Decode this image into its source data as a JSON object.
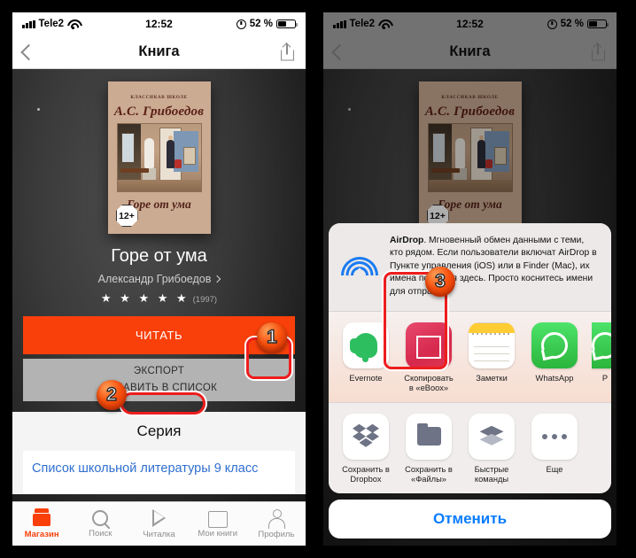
{
  "status_bar": {
    "carrier": "Tele2",
    "time": "12:52",
    "battery": "52 %"
  },
  "nav": {
    "title": "Книга",
    "back_icon": "chevron-left-icon",
    "share_icon": "share-icon"
  },
  "book": {
    "cover": {
      "series_left": "КЛАССИКА",
      "series_right": "В ШКОЛЕ",
      "author": "А.С. Грибоедов",
      "title": "Горе от ума",
      "age_rating": "12+"
    },
    "title": "Горе от ума",
    "author": "Александр Грибоедов",
    "stars": "★ ★ ★ ★ ★",
    "ratings_count": "(1997)",
    "read_button": "ЧИТАТЬ",
    "expand_icon": "chevron-up-icon",
    "export_button": "ЭКСПОРТ",
    "add_to_list_button": "ДОБАВИТЬ В СПИСОК"
  },
  "series": {
    "heading": "Серия",
    "link": "Список школьной литературы 9 класс"
  },
  "tabbar": {
    "items": [
      {
        "label": "Магазин",
        "icon": "store-icon",
        "active": true
      },
      {
        "label": "Поиск",
        "icon": "search-icon",
        "active": false
      },
      {
        "label": "Читалка",
        "icon": "play-icon",
        "active": false
      },
      {
        "label": "Мои книги",
        "icon": "book-icon",
        "active": false
      },
      {
        "label": "Профиль",
        "icon": "profile-icon",
        "active": false
      }
    ]
  },
  "share_sheet": {
    "airdrop": {
      "name": "AirDrop",
      "description": ". Мгновенный обмен данными с теми, кто рядом. Если пользователи включат AirDrop в Пункте управления (iOS) или в Finder (Mac), их имена появятся здесь. Просто коснитесь имени для отправки.",
      "icon": "airdrop-icon"
    },
    "apps": [
      {
        "label": "Evernote",
        "icon": "evernote-icon"
      },
      {
        "label": "Скопировать в «eBoox»",
        "icon": "eboox-icon"
      },
      {
        "label": "Заметки",
        "icon": "notes-icon"
      },
      {
        "label": "WhatsApp",
        "icon": "whatsapp-icon"
      },
      {
        "label": "P",
        "icon": "partial-green-app-icon"
      }
    ],
    "actions": [
      {
        "label": "Сохранить в Dropbox",
        "icon": "dropbox-icon"
      },
      {
        "label": "Сохранить в «Файлы»",
        "icon": "folder-icon"
      },
      {
        "label": "Быстрые команды",
        "icon": "shortcuts-icon"
      },
      {
        "label": "Еще",
        "icon": "more-dots-icon"
      }
    ],
    "cancel": "Отменить"
  },
  "markers": {
    "one": "1",
    "two": "2",
    "three": "3"
  },
  "colors": {
    "accent": "#f9400a",
    "link": "#2f6fd0",
    "cancel": "#0a7cff",
    "marker": "#f9530f",
    "highlight": "#ee1d1d"
  }
}
